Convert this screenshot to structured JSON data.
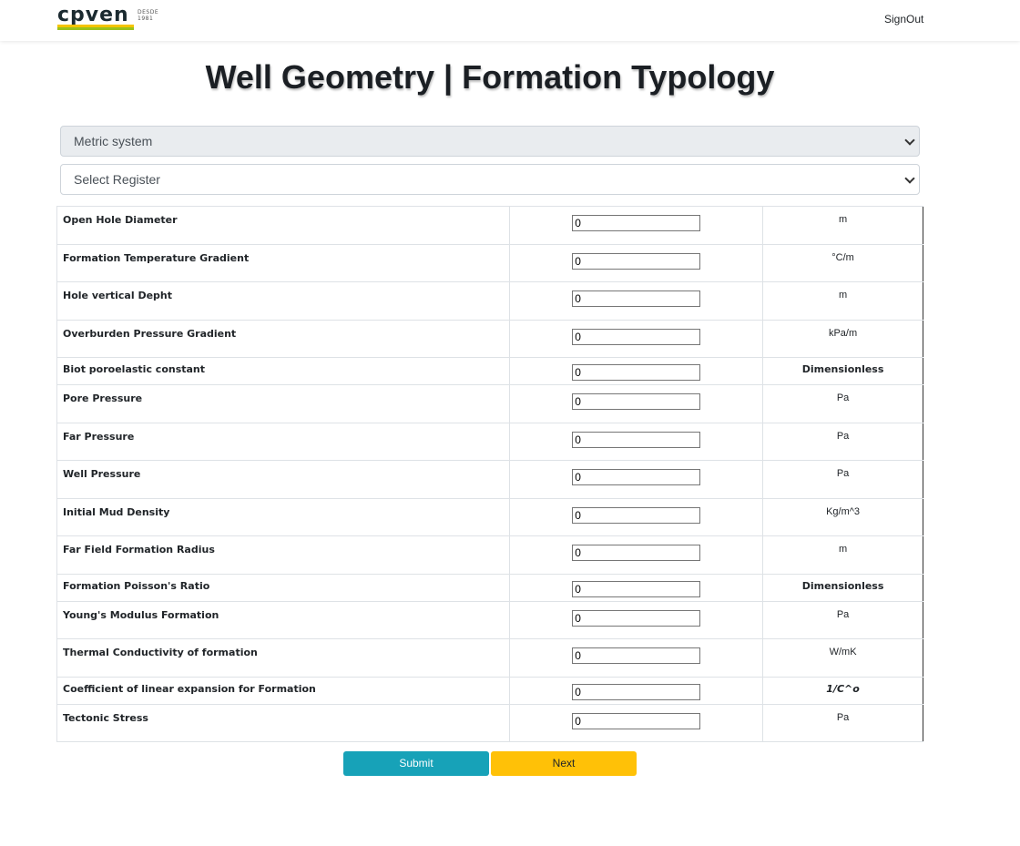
{
  "header": {
    "logo_text": "cpven",
    "logo_since": "DESDE 1981",
    "signout_label": "SignOut"
  },
  "page_title": "Well Geometry | Formation Typology",
  "selects": {
    "units_value": "Metric system",
    "register_value": "Select Register"
  },
  "parameters": [
    {
      "label": "Open Hole Diameter",
      "value": "0",
      "unit": "m"
    },
    {
      "label": "Formation Temperature Gradient",
      "value": "0",
      "unit": "°C/m"
    },
    {
      "label": "Hole vertical Depht",
      "value": "0",
      "unit": "m"
    },
    {
      "label": "Overburden Pressure Gradient",
      "value": "0",
      "unit": "kPa/m"
    },
    {
      "label": "Biot poroelastic constant",
      "value": "0",
      "unit": "Dimensionless"
    },
    {
      "label": "Pore Pressure",
      "value": "0",
      "unit": "Pa"
    },
    {
      "label": "Far Pressure",
      "value": "0",
      "unit": "Pa"
    },
    {
      "label": "Well Pressure",
      "value": "0",
      "unit": "Pa"
    },
    {
      "label": "Initial Mud Density",
      "value": "0",
      "unit": "Kg/m^3"
    },
    {
      "label": "Far Field Formation Radius",
      "value": "0",
      "unit": "m"
    },
    {
      "label": "Formation Poisson's Ratio",
      "value": "0",
      "unit": "Dimensionless"
    },
    {
      "label": "Young's Modulus Formation",
      "value": "0",
      "unit": "Pa"
    },
    {
      "label": "Thermal Conductivity of formation",
      "value": "0",
      "unit": "W/mK"
    },
    {
      "label": "Coefficient of linear expansion for Formation",
      "value": "0",
      "unit": "1/C^o"
    },
    {
      "label": "Tectonic Stress",
      "value": "0",
      "unit": "Pa"
    }
  ],
  "buttons": {
    "submit_label": "Submit",
    "next_label": "Next"
  },
  "colors": {
    "submit": "#17a2b8",
    "next": "#ffc107",
    "logo_yellow": "#f5c400",
    "logo_green": "#9bc21d"
  }
}
